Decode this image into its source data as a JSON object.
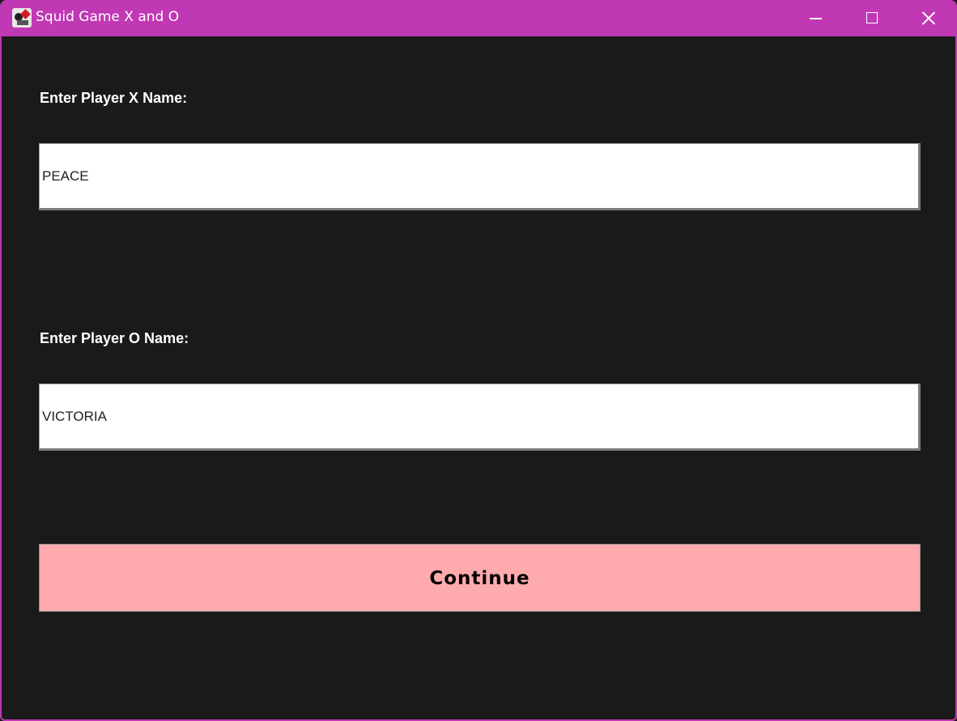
{
  "window": {
    "title": "Squid Game X and O",
    "icon": "squid-game-app-icon",
    "controls": [
      "minimize-icon",
      "maximize-icon",
      "close-icon"
    ],
    "accent_color": "#c038b4"
  },
  "form": {
    "player_x_label": "Enter Player X Name:",
    "player_x_value": "PEACE",
    "player_o_label": "Enter Player O Name:",
    "player_o_value": "VICTORIA",
    "continue_label": "Continue",
    "continue_color": "#ffabad",
    "background_color": "#1a1a1a"
  }
}
